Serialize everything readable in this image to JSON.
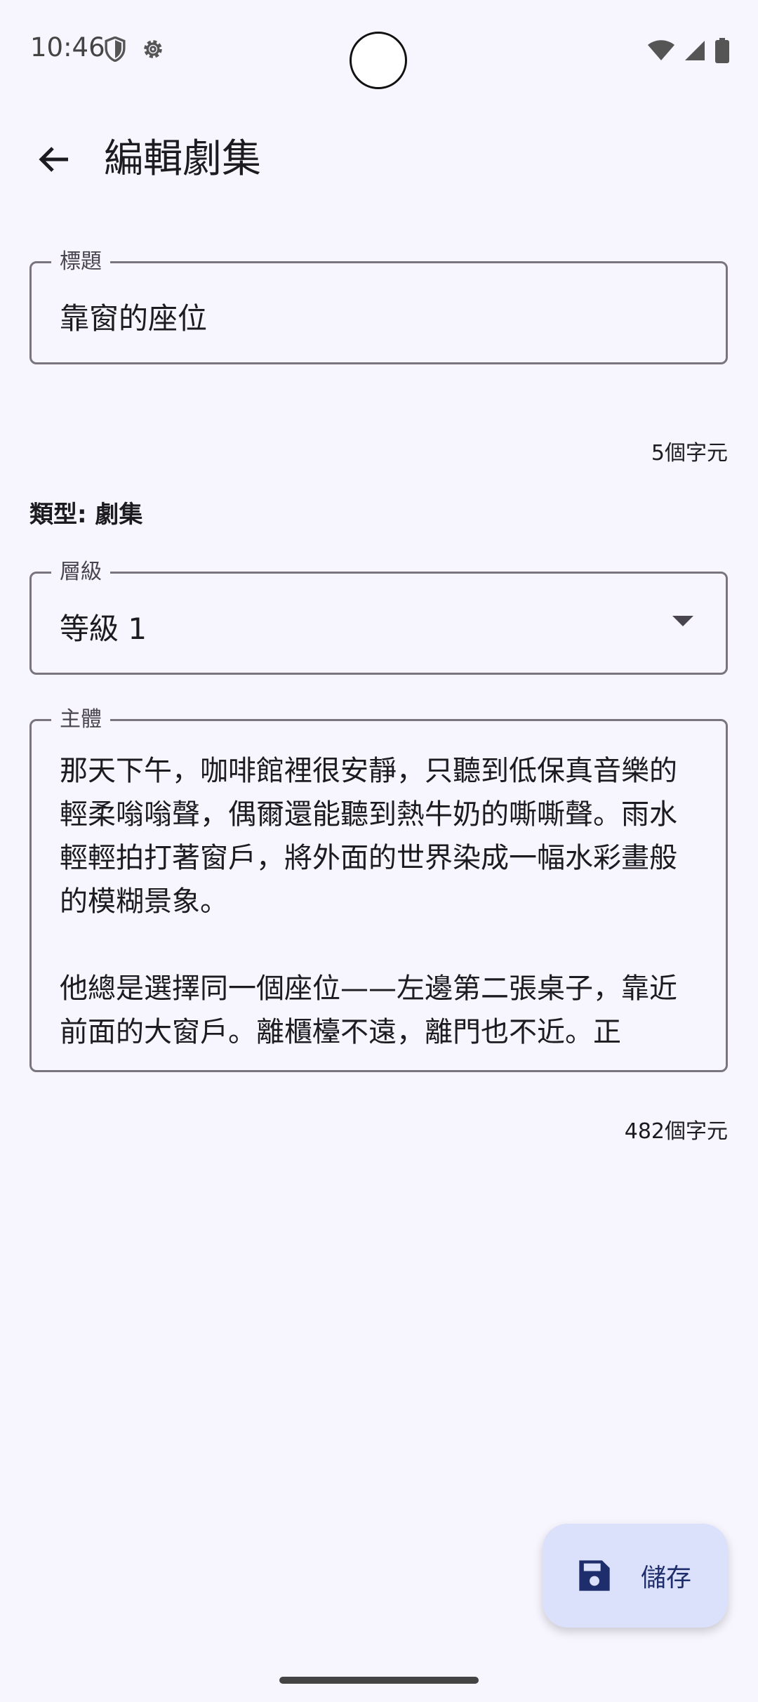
{
  "status_bar": {
    "time": "10:46"
  },
  "app_bar": {
    "title": "編輯劇集"
  },
  "title_field": {
    "label": "標題",
    "value": "靠窗的座位",
    "counter": "5個字元"
  },
  "type_info": "類型: 劇集",
  "tier_field": {
    "label": "層級",
    "value": "等級 1"
  },
  "body_field": {
    "label": "主體",
    "value": "那天下午，咖啡館裡很安靜，只聽到低保真音樂的輕柔嗡嗡聲，偶爾還能聽到熱牛奶的嘶嘶聲。雨水輕輕拍打著窗戶，將外面的世界染成一幅水彩畫般的模糊景象。\n\n他總是選擇同一個座位——左邊第二張桌子，靠近前面的大窗戶。離櫃檯不遠，離門也不近。正",
    "counter": "482個字元"
  },
  "fab": {
    "label": "儲存"
  }
}
